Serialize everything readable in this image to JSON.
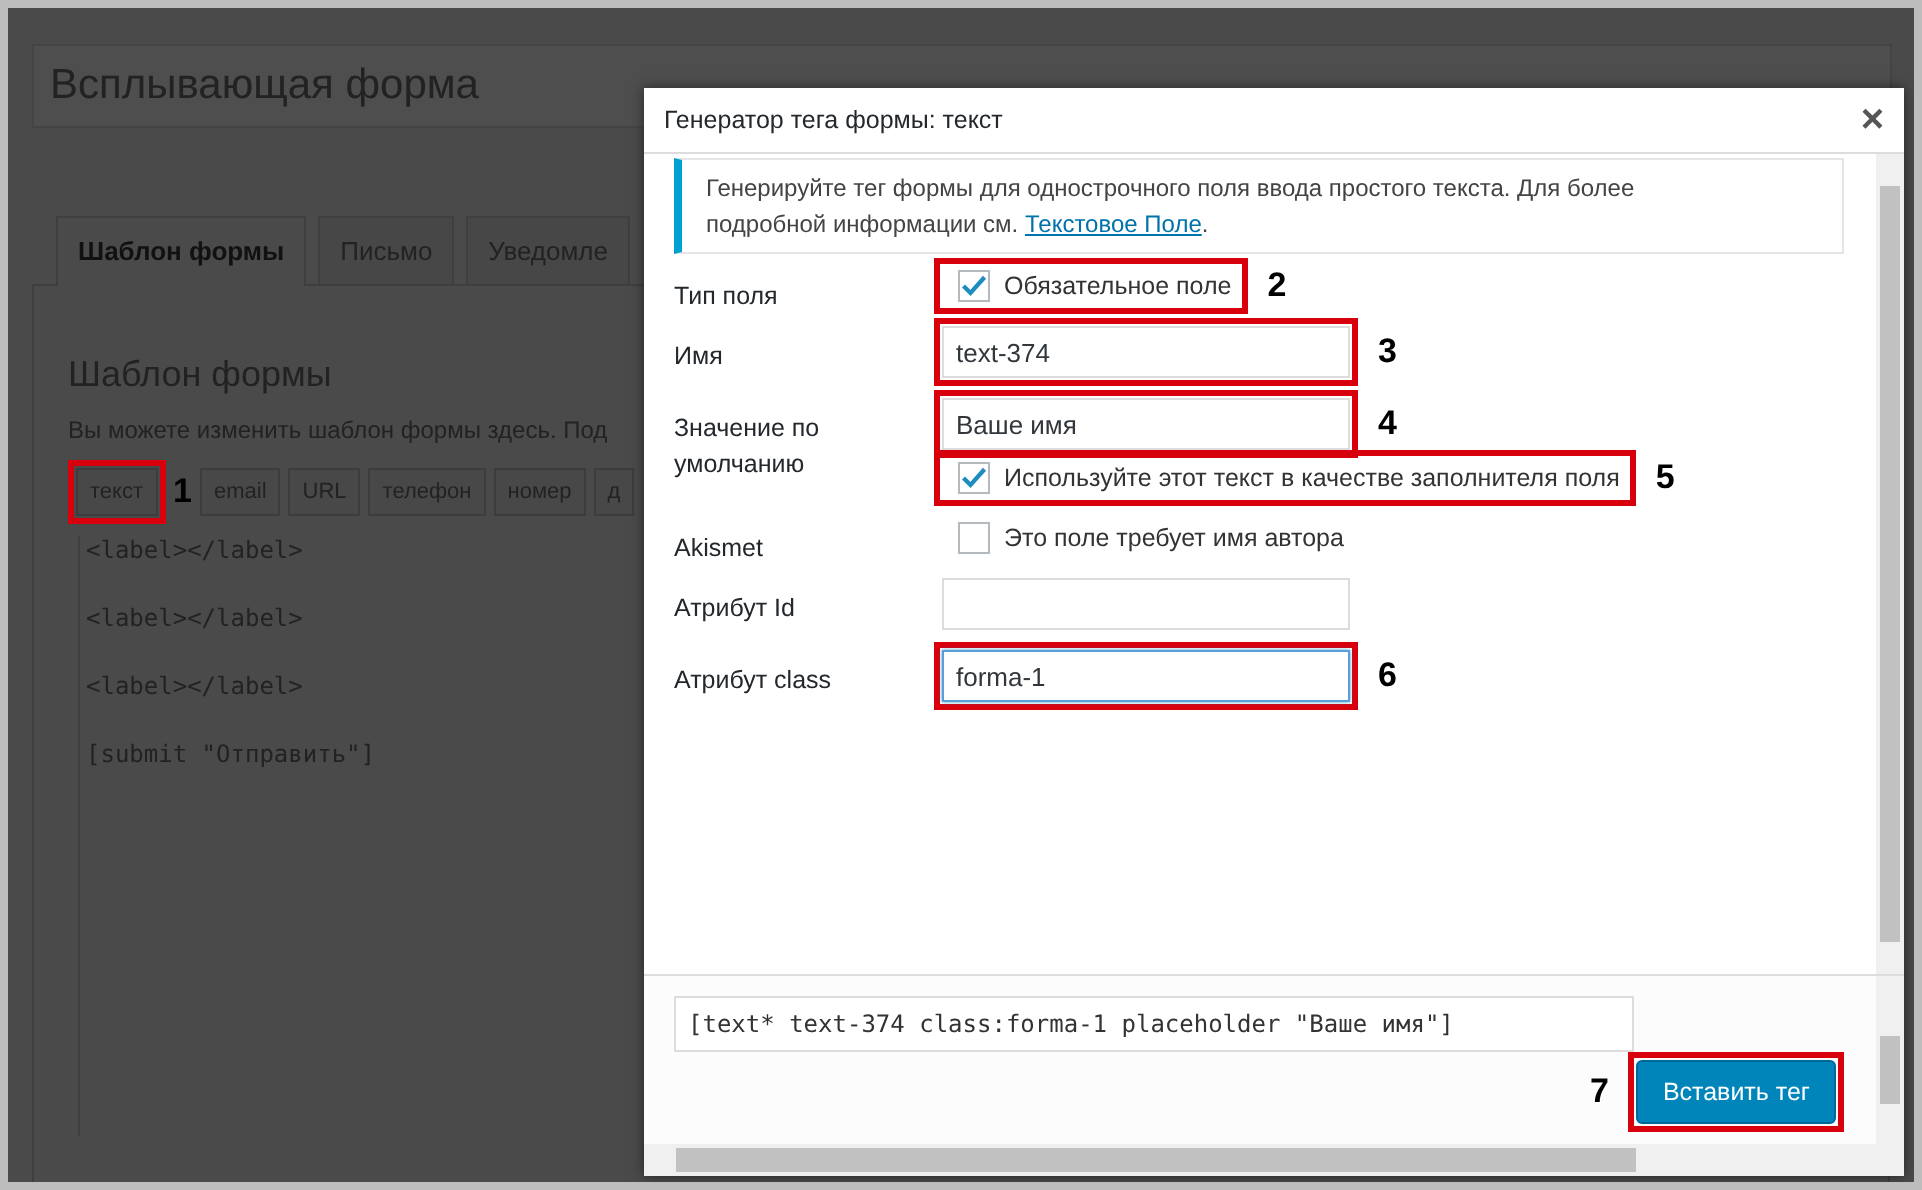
{
  "page": {
    "title_value": "Всплывающая форма",
    "tabs": [
      {
        "label": "Шаблон формы",
        "selected": true
      },
      {
        "label": "Письмо",
        "selected": false
      },
      {
        "label": "Уведомле",
        "selected": false
      }
    ],
    "section_title": "Шаблон формы",
    "description": "Вы можете изменить шаблон формы здесь. Под",
    "tag_buttons": [
      {
        "label": "текст",
        "marker": "1"
      },
      {
        "label": "email"
      },
      {
        "label": "URL"
      },
      {
        "label": "телефон"
      },
      {
        "label": "номер"
      },
      {
        "label": "д"
      }
    ],
    "template_lines": [
      "<label></label>",
      "<label></label>",
      "<label></label>",
      "[submit \"Отправить\"]"
    ]
  },
  "dialog": {
    "title": "Генератор тега формы: текст",
    "close": "×",
    "notice": {
      "text": "Генерируйте тег формы для однострочного поля ввода простого текста. Для более подробной информации см.",
      "link": "Текстовое Поле",
      "end": "."
    },
    "rows": [
      {
        "kind": "checkbox",
        "label": "Тип поля",
        "option": "Обязательное поле",
        "checked": true,
        "marker": "2"
      },
      {
        "kind": "text",
        "label": "Имя",
        "value": "text-374",
        "marker": "3"
      },
      {
        "kind": "text_with_option",
        "label": "Значение по умолчанию",
        "value": "Ваше имя",
        "marker": "4",
        "option": "Используйте этот текст в качестве заполнителя поля",
        "checked": true,
        "option_marker": "5"
      },
      {
        "kind": "checkbox",
        "label": "Akismet",
        "option": "Это поле требует имя автора",
        "checked": false
      },
      {
        "kind": "text",
        "label": "Атрибут Id"
      },
      {
        "kind": "text",
        "label": "Атрибут class",
        "value": "forma-1",
        "focused": true,
        "marker": "6"
      }
    ],
    "generated_tag": "[text* text-374 class:forma-1 placeholder \"Ваше имя\"]",
    "insert_button": "Вставить тег",
    "insert_marker": "7"
  }
}
